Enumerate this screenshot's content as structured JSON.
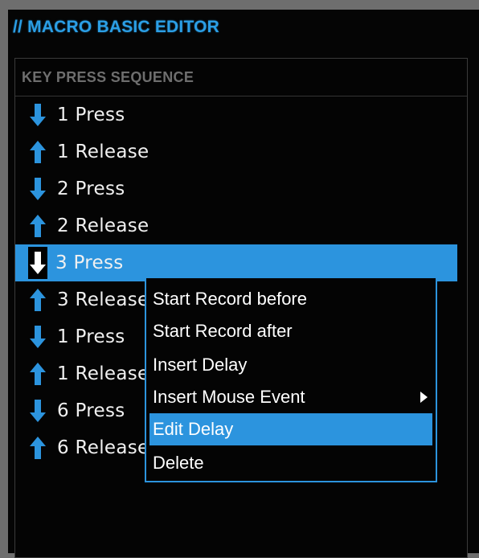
{
  "panel": {
    "title": "// MACRO BASIC EDITOR"
  },
  "list": {
    "header": "KEY PRESS SEQUENCE",
    "items": [
      {
        "icon": "arrow-down-icon",
        "label": "1 Press"
      },
      {
        "icon": "arrow-up-icon",
        "label": "1 Release"
      },
      {
        "icon": "arrow-down-icon",
        "label": "2 Press"
      },
      {
        "icon": "arrow-up-icon",
        "label": "2 Release"
      },
      {
        "icon": "arrow-down-icon",
        "label": "3 Press",
        "selected": true
      },
      {
        "icon": "arrow-up-icon",
        "label": "3 Release"
      },
      {
        "icon": "arrow-down-icon",
        "label": "1 Press"
      },
      {
        "icon": "arrow-up-icon",
        "label": "1 Release"
      },
      {
        "icon": "arrow-down-icon",
        "label": "6 Press"
      },
      {
        "icon": "arrow-up-icon",
        "label": "6 Release"
      }
    ]
  },
  "context_menu": {
    "items": [
      {
        "label": "Start Record before"
      },
      {
        "label": "Start Record after"
      },
      {
        "label": "Insert Delay"
      },
      {
        "label": "Insert Mouse Event",
        "submenu": true
      },
      {
        "label": "Edit Delay",
        "highlighted": true
      },
      {
        "label": "Delete"
      }
    ]
  },
  "colors": {
    "accent": "#2c94de",
    "title": "#2b9fe6",
    "background": "#040404",
    "header_text": "#6e6e6e",
    "text": "#f0f0f0"
  }
}
